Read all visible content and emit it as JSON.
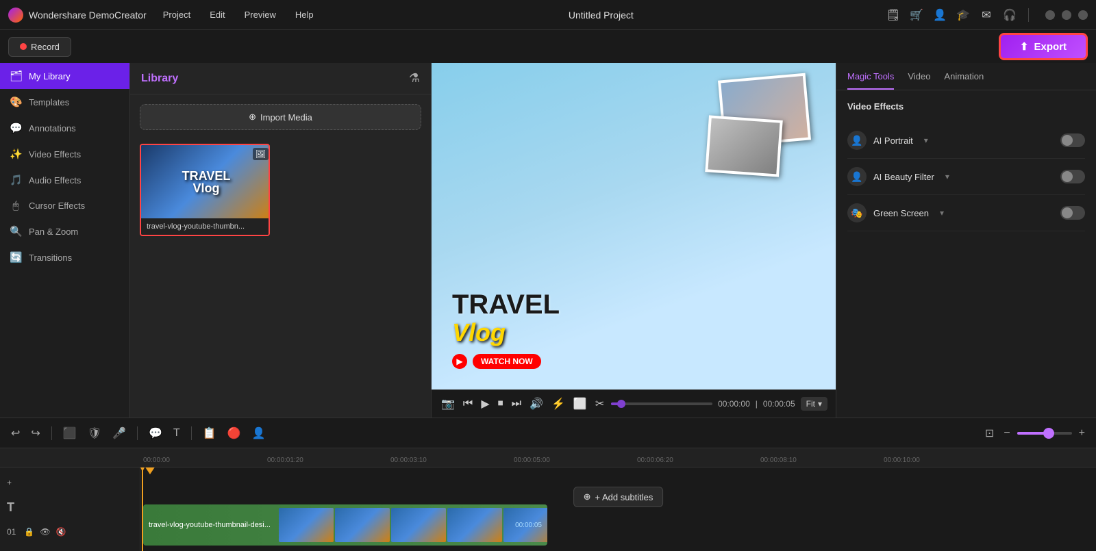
{
  "app": {
    "name": "Wondershare DemoCreator",
    "project_title": "Untitled Project"
  },
  "topbar": {
    "menu_items": [
      "Project",
      "Edit",
      "Preview",
      "Help"
    ],
    "record_label": "Record",
    "export_label": "Export"
  },
  "sidebar": {
    "items": [
      {
        "id": "my-library",
        "label": "My Library",
        "icon": "🗂",
        "active": true
      },
      {
        "id": "templates",
        "label": "Templates",
        "icon": "🎨",
        "active": false
      },
      {
        "id": "annotations",
        "label": "Annotations",
        "icon": "💬",
        "active": false
      },
      {
        "id": "video-effects",
        "label": "Video Effects",
        "icon": "✨",
        "active": false
      },
      {
        "id": "audio-effects",
        "label": "Audio Effects",
        "icon": "🎵",
        "active": false
      },
      {
        "id": "cursor-effects",
        "label": "Cursor Effects",
        "icon": "🖱",
        "active": false
      },
      {
        "id": "pan-zoom",
        "label": "Pan & Zoom",
        "icon": "🔍",
        "active": false
      },
      {
        "id": "transitions",
        "label": "Transitions",
        "icon": "🔄",
        "active": false
      }
    ]
  },
  "library": {
    "title": "Library",
    "import_label": "Import Media",
    "media_items": [
      {
        "name": "travel-vlog-youtube-thumbn...",
        "type": "image"
      }
    ]
  },
  "preview": {
    "time_current": "00:00:00",
    "time_total": "00:00:05",
    "fit_label": "Fit",
    "add_subtitles_label": "+ Add subtitles"
  },
  "right_panel": {
    "tabs": [
      {
        "id": "magic-tools",
        "label": "Magic Tools",
        "active": true
      },
      {
        "id": "video",
        "label": "Video",
        "active": false
      },
      {
        "id": "animation",
        "label": "Animation",
        "active": false
      }
    ],
    "video_effects_label": "Video Effects",
    "effects": [
      {
        "id": "ai-portrait",
        "label": "AI Portrait",
        "enabled": false
      },
      {
        "id": "ai-beauty-filter",
        "label": "AI Beauty Filter",
        "enabled": false
      },
      {
        "id": "green-screen",
        "label": "Green Screen",
        "enabled": false
      }
    ]
  },
  "timeline": {
    "clip_label": "travel-vlog-youtube-thumbnail-desi...",
    "clip_duration": "00:00:05",
    "ruler_marks": [
      "00:00:00",
      "00:00:01:20",
      "00:00:03:10",
      "00:00:05:00",
      "00:00:06:20",
      "00:00:08:10",
      "00:00:10:00"
    ],
    "add_subtitles": "+ Add subtitles"
  },
  "icons": {
    "undo": "↩",
    "redo": "↪",
    "crop": "⬛",
    "shield": "🛡",
    "mic": "🎤",
    "comment": "💬",
    "text": "T",
    "copy": "📋",
    "person": "👤",
    "camera": "📷",
    "prev": "⏮",
    "play": "▶",
    "stop": "⏹",
    "next": "⏭",
    "volume": "🔊",
    "speed": "⚡",
    "cut": "✂",
    "fullscreen": "⛶",
    "pip": "📺",
    "zoom_in": "+",
    "zoom_out": "−",
    "fit_frame": "⊡",
    "plus": "+",
    "eye": "👁",
    "lock": "🔒",
    "mute": "🔇",
    "layers": "≡"
  }
}
